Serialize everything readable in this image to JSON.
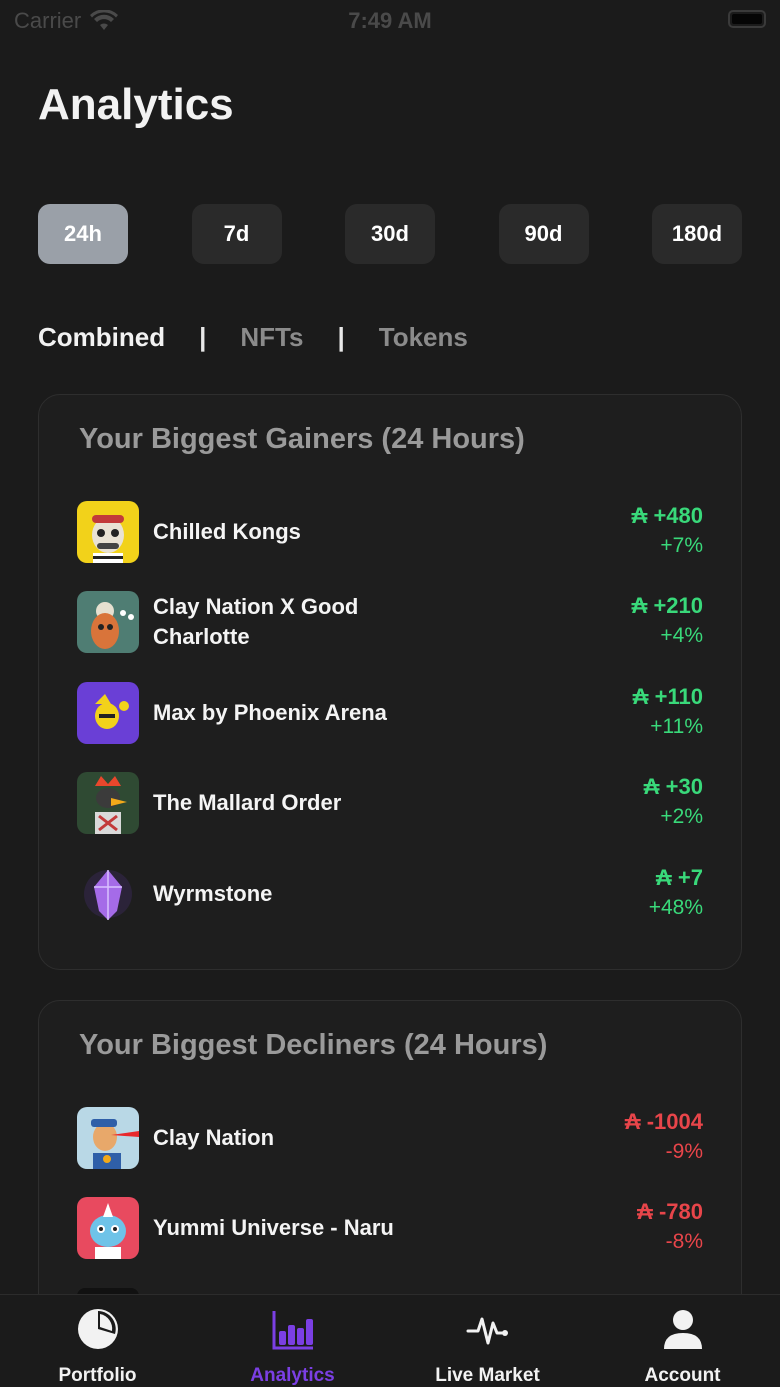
{
  "status_bar": {
    "carrier": "Carrier",
    "time": "7:49 AM"
  },
  "page": {
    "title": "Analytics"
  },
  "time_ranges": [
    {
      "label": "24h",
      "active": true
    },
    {
      "label": "7d",
      "active": false
    },
    {
      "label": "30d",
      "active": false
    },
    {
      "label": "90d",
      "active": false
    },
    {
      "label": "180d",
      "active": false
    }
  ],
  "segments": [
    {
      "label": "Combined",
      "active": true
    },
    {
      "label": "NFTs",
      "active": false
    },
    {
      "label": "Tokens",
      "active": false
    }
  ],
  "segment_separator": "|",
  "gainers": {
    "title": "Your Biggest Gainers (24 Hours)",
    "items": [
      {
        "name": "Chilled Kongs",
        "amount": "₳ +480",
        "percent": "+7%",
        "thumb_color": "#f2d21a"
      },
      {
        "name": "Clay Nation X Good Charlotte",
        "amount": "₳ +210",
        "percent": "+4%",
        "thumb_color": "#4f7d73"
      },
      {
        "name": "Max by Phoenix Arena",
        "amount": "₳ +110",
        "percent": "+11%",
        "thumb_color": "#6a3fd6"
      },
      {
        "name": "The Mallard Order",
        "amount": "₳ +30",
        "percent": "+2%",
        "thumb_color": "#2f4a33"
      },
      {
        "name": "Wyrmstone",
        "amount": "₳ +7",
        "percent": "+48%",
        "thumb_color": "#1e1e1e"
      }
    ]
  },
  "decliners": {
    "title": "Your Biggest Decliners (24 Hours)",
    "items": [
      {
        "name": "Clay Nation",
        "amount": "₳ -1004",
        "percent": "-9%",
        "thumb_color": "#b9d8e6"
      },
      {
        "name": "Yummi Universe - Naru",
        "amount": "₳ -780",
        "percent": "-8%",
        "thumb_color": "#e84a5f"
      }
    ]
  },
  "tab_bar": {
    "tabs": [
      {
        "label": "Portfolio",
        "icon": "pie-chart-icon",
        "active": false
      },
      {
        "label": "Analytics",
        "icon": "bar-chart-icon",
        "active": true
      },
      {
        "label": "Live Market",
        "icon": "pulse-icon",
        "active": false
      },
      {
        "label": "Account",
        "icon": "person-icon",
        "active": false
      }
    ]
  },
  "colors": {
    "gain": "#39d97a",
    "loss": "#e8454a",
    "accent": "#7b3fe4",
    "active_range": "#9aa0a8"
  }
}
